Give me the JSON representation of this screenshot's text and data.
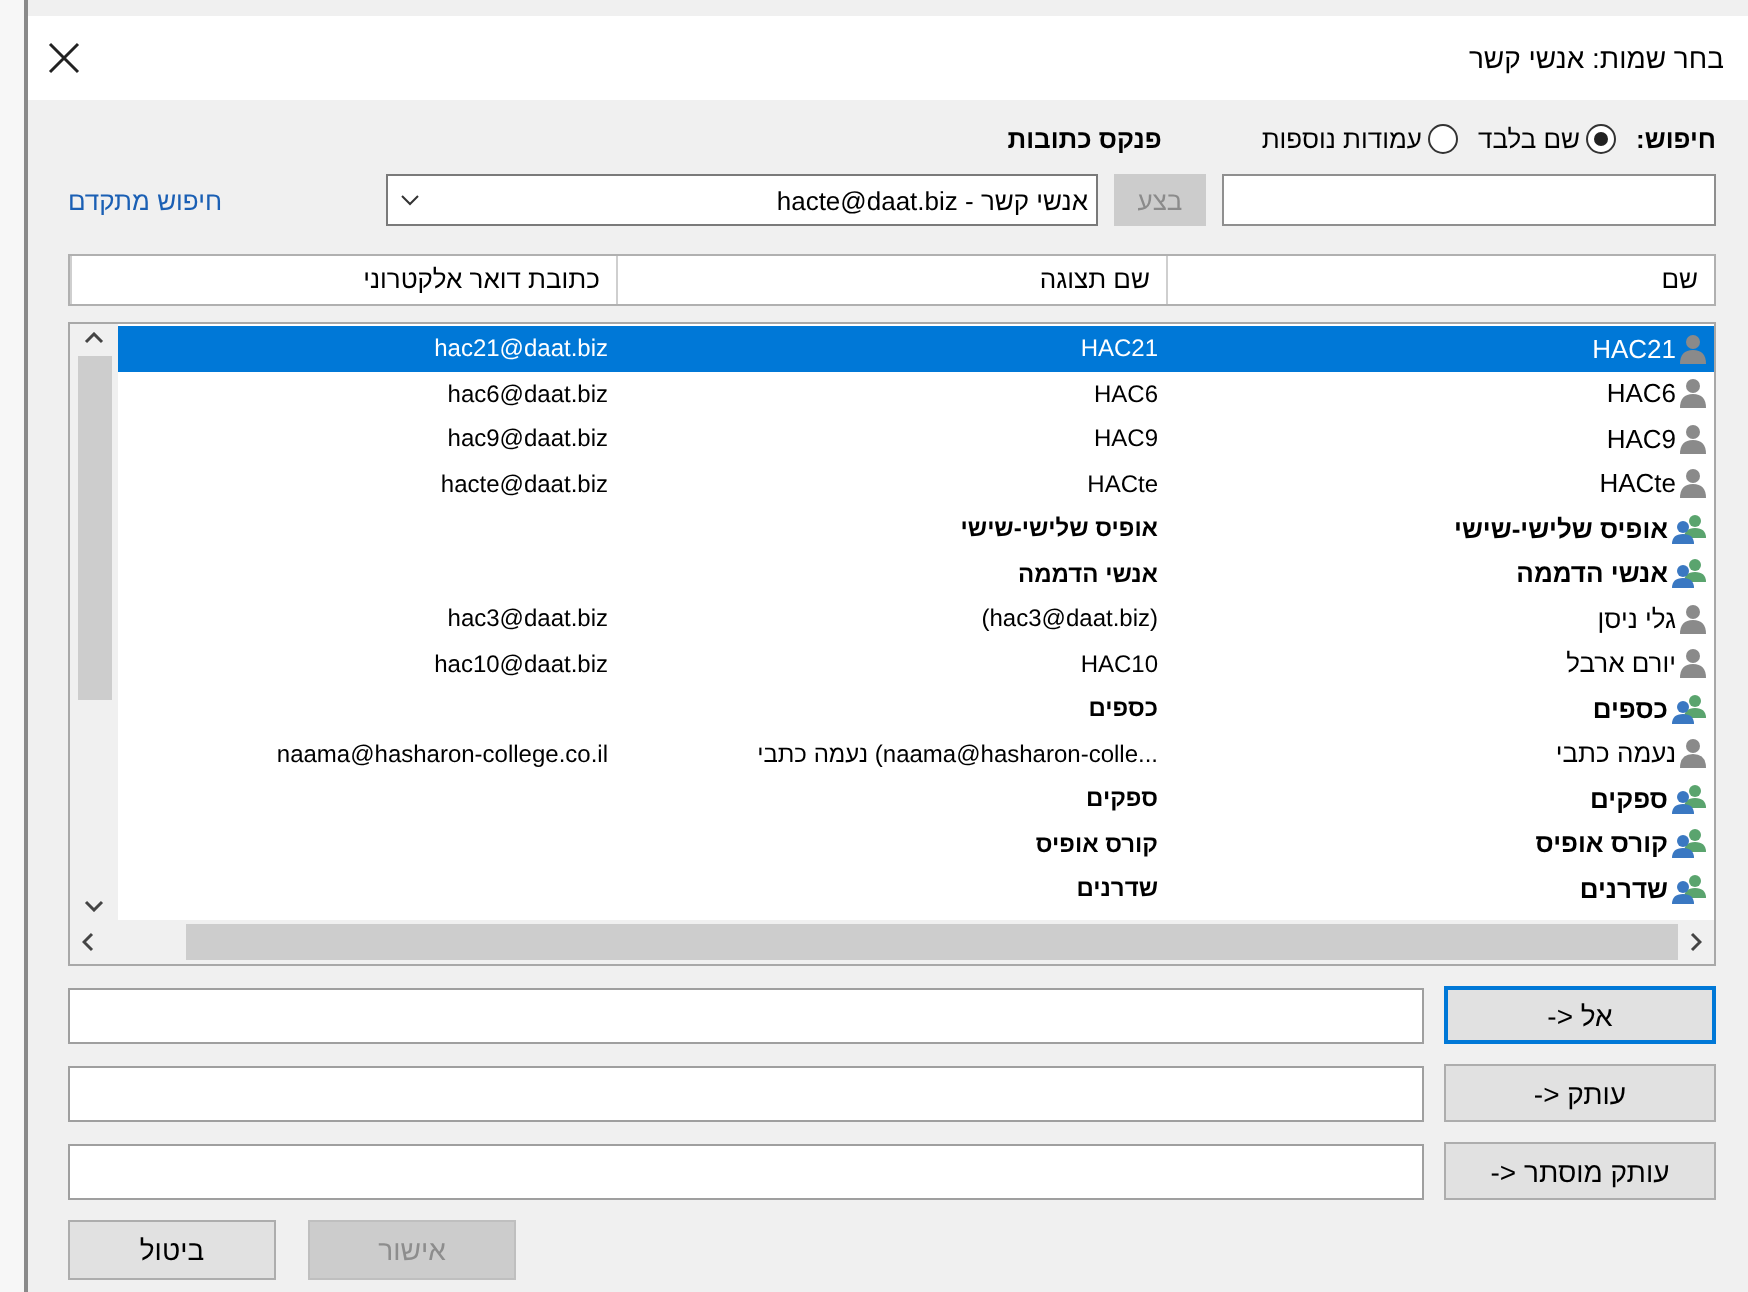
{
  "window": {
    "title": "בחר שמות: אנשי קשר"
  },
  "search": {
    "label": "חיפוש:",
    "options": [
      {
        "label": "שם בלבד",
        "selected": true
      },
      {
        "label": "עמודות נוספות",
        "selected": false
      }
    ],
    "go_button": {
      "label": "בצע",
      "disabled": true
    }
  },
  "address_book": {
    "label": "פנקס כתובות",
    "value": "אנשי קשר - hacte@daat.biz"
  },
  "advanced_search": "חיפוש מתקדם",
  "table": {
    "columns": [
      "שם",
      "שם תצוגה",
      "כתובת דואר אלקטרוני"
    ],
    "rows": [
      {
        "kind": "contact",
        "name": "HAC21",
        "display": "HAC21",
        "email": "hac21@daat.biz",
        "selected": true
      },
      {
        "kind": "contact",
        "name": "HAC6",
        "display": "HAC6",
        "email": "hac6@daat.biz",
        "selected": false
      },
      {
        "kind": "contact",
        "name": "HAC9",
        "display": "HAC9",
        "email": "hac9@daat.biz",
        "selected": false
      },
      {
        "kind": "contact",
        "name": "HACte",
        "display": "HACte",
        "email": "hacte@daat.biz",
        "selected": false
      },
      {
        "kind": "group",
        "name": "אופיס שלישי-שישי",
        "display": "אופיס שלישי-שישי",
        "selected": false
      },
      {
        "kind": "group",
        "name": "אנשי הדממה",
        "display": "אנשי הדממה",
        "selected": false
      },
      {
        "kind": "contact",
        "name": "גלי ניסן",
        "display": "(hac3@daat.biz)",
        "email": "hac3@daat.biz",
        "selected": false
      },
      {
        "kind": "contact",
        "name": "יורם ארבל",
        "display": "HAC10",
        "email": "hac10@daat.biz",
        "selected": false
      },
      {
        "kind": "group",
        "name": "כספים",
        "display": "כספים",
        "selected": false
      },
      {
        "kind": "contact",
        "name": "נעמה כתבי",
        "display": "נעמה כתבי (naama@hasharon-colle...",
        "email": "naama@hasharon-college.co.il",
        "selected": false
      },
      {
        "kind": "group",
        "name": "ספקים",
        "display": "ספקים",
        "selected": false
      },
      {
        "kind": "group",
        "name": "קורס אופיס",
        "display": "קורס אופיס",
        "selected": false
      },
      {
        "kind": "group",
        "name": "שדרנים",
        "display": "שדרנים",
        "selected": false
      }
    ]
  },
  "recipients": [
    {
      "label": "-> אל",
      "focused": true
    },
    {
      "label": "-> עותק",
      "focused": false
    },
    {
      "label": "-> עותק מוסתר",
      "focused": false
    }
  ],
  "buttons": [
    {
      "label": "אישור",
      "disabled": true
    },
    {
      "label": "ביטול",
      "disabled": false
    }
  ]
}
